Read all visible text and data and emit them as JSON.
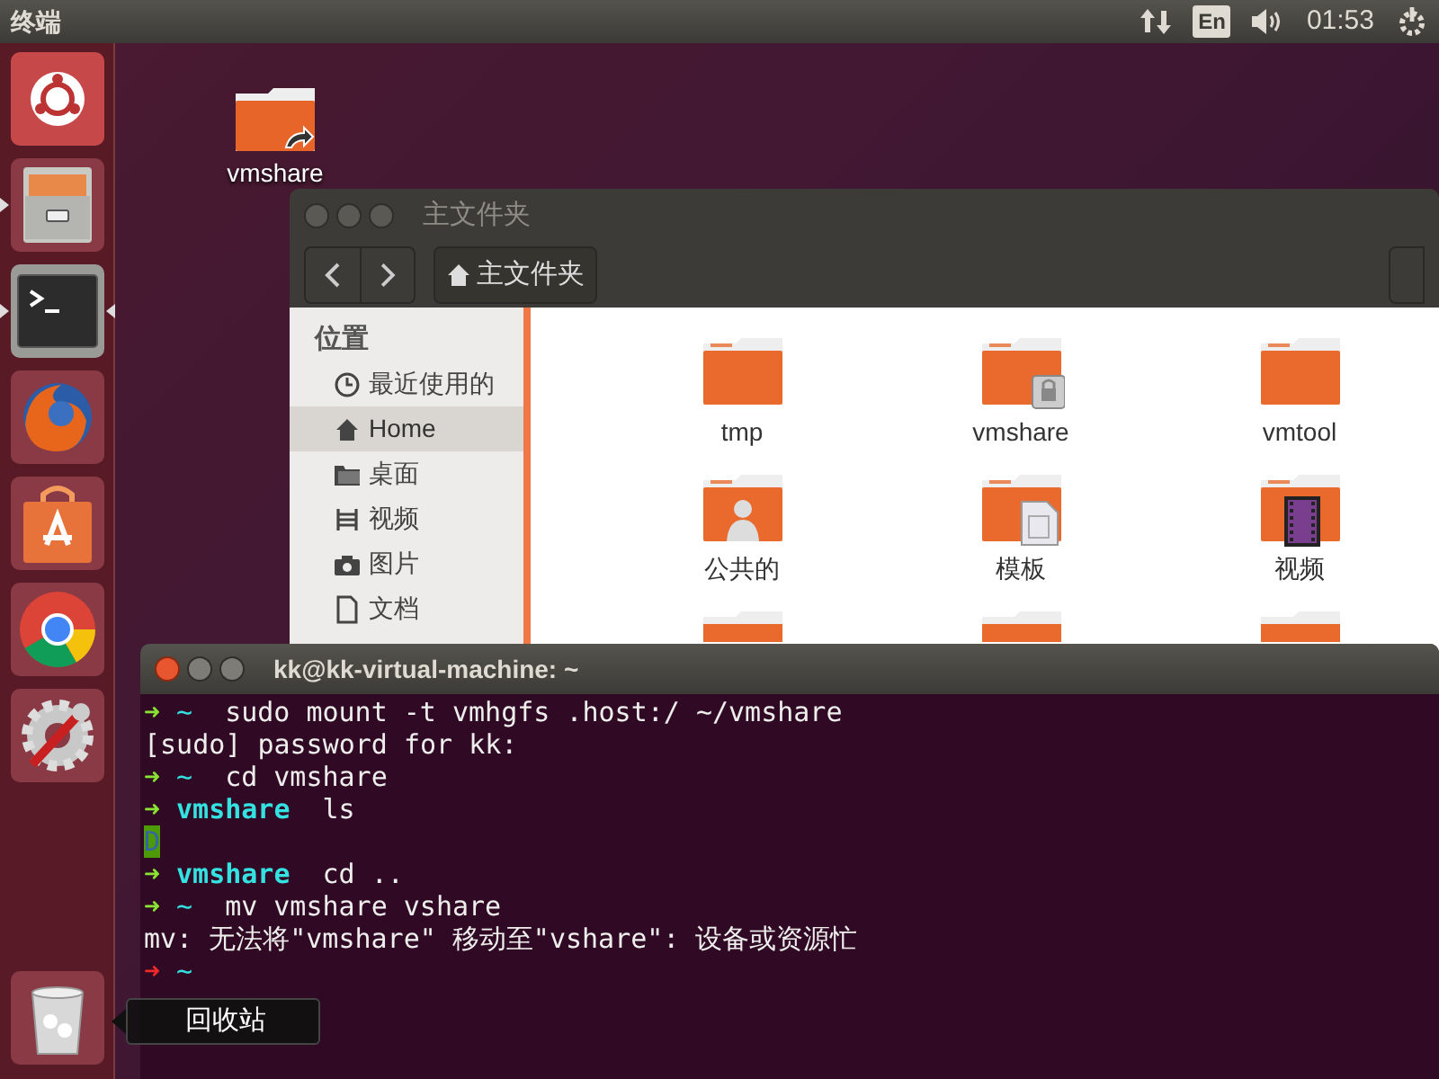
{
  "top_panel": {
    "app_title": "终端",
    "keyboard_layout": "En",
    "clock": "01:53"
  },
  "launcher": {
    "items": [
      {
        "kind": "ubuntu",
        "running": false,
        "focused": false
      },
      {
        "kind": "files",
        "running": true,
        "focused": false
      },
      {
        "kind": "terminal",
        "running": true,
        "focused": true
      },
      {
        "kind": "firefox",
        "running": false,
        "focused": false
      },
      {
        "kind": "software",
        "running": false,
        "focused": false
      },
      {
        "kind": "chrome",
        "running": false,
        "focused": false
      },
      {
        "kind": "settings",
        "running": false,
        "focused": false
      }
    ],
    "trash": {
      "tooltip": "回收站"
    }
  },
  "desktop_icons": [
    {
      "label": "vmshare",
      "link": true
    }
  ],
  "file_manager": {
    "title": "主文件夹",
    "path_button": "主文件夹",
    "sidebar": {
      "heading": "位置",
      "items": [
        {
          "label": "最近使用的",
          "kind": "recent",
          "selected": false
        },
        {
          "label": "Home",
          "kind": "home",
          "selected": true
        },
        {
          "label": "桌面",
          "kind": "desktop",
          "selected": false
        },
        {
          "label": "视频",
          "kind": "videos",
          "selected": false
        },
        {
          "label": "图片",
          "kind": "pictures",
          "selected": false
        },
        {
          "label": "文档",
          "kind": "documents",
          "selected": false
        }
      ]
    },
    "items": [
      {
        "label": "tmp",
        "kind": "plain"
      },
      {
        "label": "vmshare",
        "kind": "locked"
      },
      {
        "label": "vmtool",
        "kind": "plain"
      },
      {
        "label": "公共的",
        "kind": "public"
      },
      {
        "label": "模板",
        "kind": "templates"
      },
      {
        "label": "视频",
        "kind": "videos"
      }
    ]
  },
  "terminal": {
    "title": "kk@kk-virtual-machine: ~",
    "lines": [
      [
        {
          "kind": "prompt_ok",
          "text": "➜"
        },
        {
          "kind": "dir",
          "text": "~"
        },
        {
          "kind": "cmd",
          "text": "sudo mount -t vmhgfs .host:/ ~/vmshare"
        }
      ],
      [
        {
          "kind": "out",
          "text": "[sudo] password for kk:"
        }
      ],
      [
        {
          "kind": "prompt_ok",
          "text": "➜"
        },
        {
          "kind": "dir",
          "text": "~"
        },
        {
          "kind": "cmd",
          "text": "cd vmshare"
        }
      ],
      [
        {
          "kind": "prompt_ok",
          "text": "➜"
        },
        {
          "kind": "dir_bold",
          "text": "vmshare"
        },
        {
          "kind": "cmd",
          "text": "ls"
        }
      ],
      [
        {
          "kind": "highlight",
          "text": "D"
        }
      ],
      [
        {
          "kind": "prompt_ok",
          "text": "➜"
        },
        {
          "kind": "dir_bold",
          "text": "vmshare"
        },
        {
          "kind": "cmd",
          "text": "cd .."
        }
      ],
      [
        {
          "kind": "prompt_ok",
          "text": "➜"
        },
        {
          "kind": "dir",
          "text": "~"
        },
        {
          "kind": "cmd",
          "text": "mv vmshare vshare"
        }
      ],
      [
        {
          "kind": "out",
          "text": "mv: 无法将\"vmshare\" 移动至\"vshare\": 设备或资源忙"
        }
      ],
      [
        {
          "kind": "prompt_err",
          "text": "➜"
        },
        {
          "kind": "dir",
          "text": "~"
        }
      ]
    ]
  }
}
